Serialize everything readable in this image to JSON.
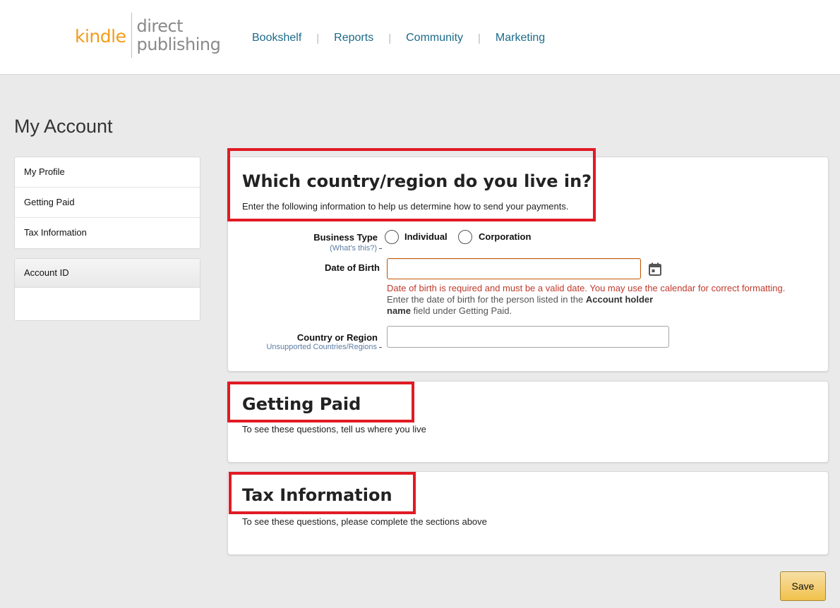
{
  "logo": {
    "kindle": "kindle",
    "line1": "direct",
    "line2": "publishing"
  },
  "nav": {
    "items": [
      "Bookshelf",
      "Reports",
      "Community",
      "Marketing"
    ],
    "separator": "|"
  },
  "page_title": "My Account",
  "sidebar": {
    "items": [
      {
        "label": "My Profile"
      },
      {
        "label": "Getting Paid"
      },
      {
        "label": "Tax Information"
      }
    ],
    "account_id_label": "Account ID"
  },
  "country_section": {
    "title": "Which country/region do you live in?",
    "subtitle": "Enter the following information to help us determine how to send your payments.",
    "business_type": {
      "label": "Business Type",
      "help": "(What's this?)",
      "options": [
        "Individual",
        "Corporation"
      ]
    },
    "dob": {
      "label": "Date of Birth",
      "value": "",
      "error": "Date of birth is required and must be a valid date. You may use the calendar for correct formatting.",
      "hint_1": "Enter the date of birth for the person listed in the",
      "hint_bold_1": "Account holder",
      "hint_bold_2": "name",
      "hint_2": "field under Getting Paid."
    },
    "country": {
      "label": "Country or Region",
      "help": "Unsupported Countries/Regions",
      "value": ""
    }
  },
  "getting_paid": {
    "title": "Getting Paid",
    "text": "To see these questions, tell us where you live"
  },
  "tax_info": {
    "title": "Tax Information",
    "text": "To see these questions, please complete the sections above"
  },
  "save_label": "Save",
  "colors": {
    "highlight": "#e01b24",
    "link": "#1b6b8a",
    "error": "#c0392b",
    "logo_kindle": "#f39c1a",
    "save_button": "#f0c14b"
  },
  "icons": {
    "calendar": "calendar-icon"
  }
}
